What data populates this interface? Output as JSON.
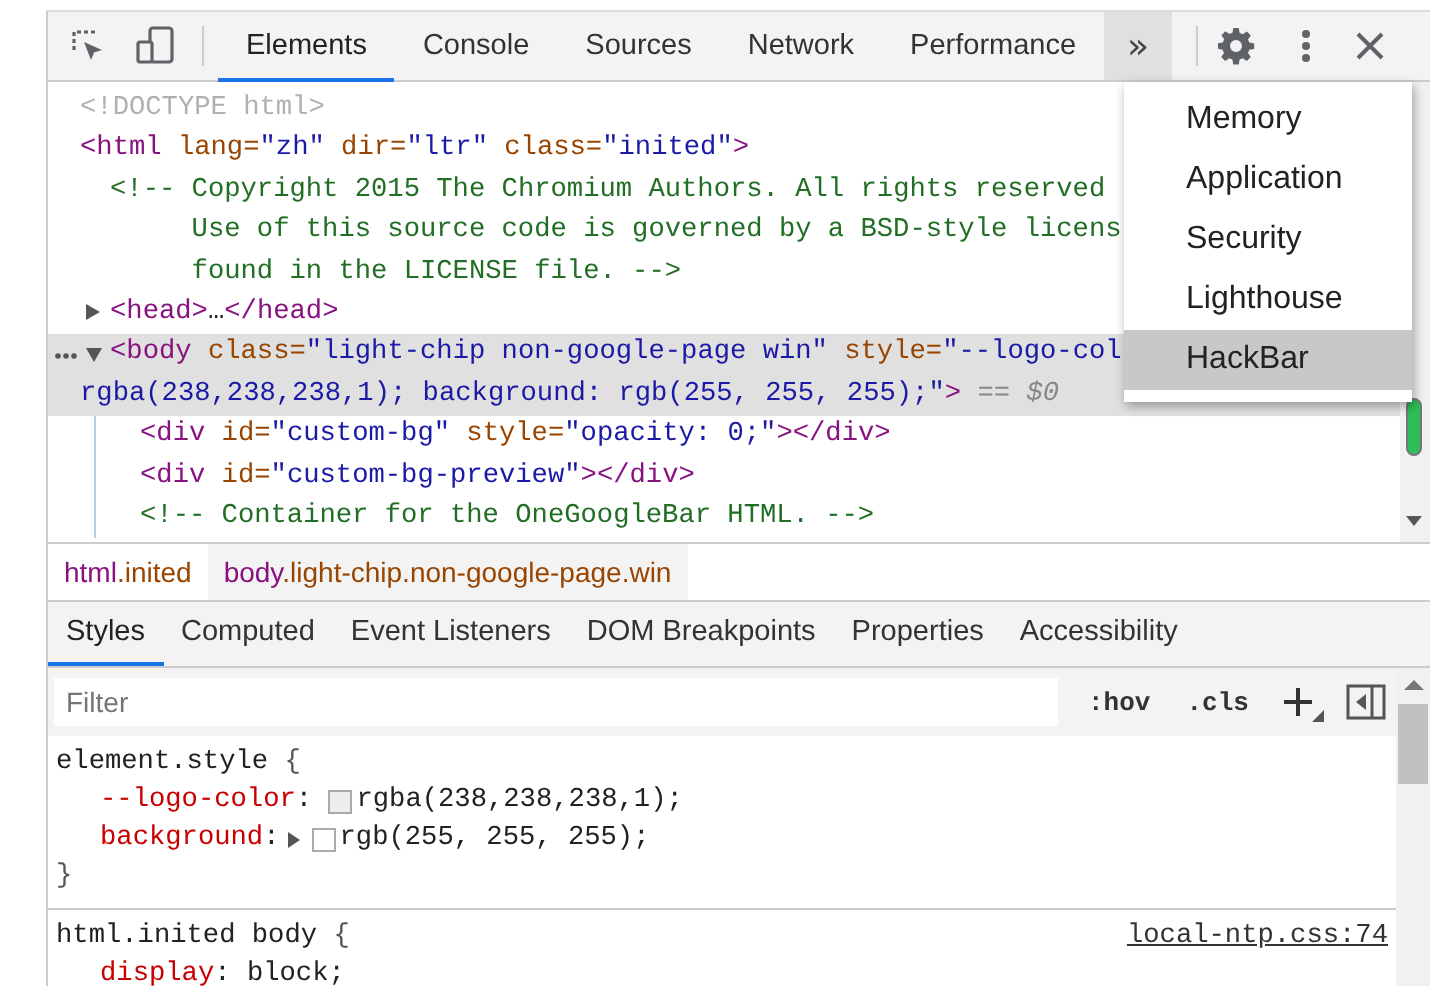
{
  "toolbar": {
    "tabs": [
      {
        "label": "Elements",
        "selected": true
      },
      {
        "label": "Console",
        "selected": false
      },
      {
        "label": "Sources",
        "selected": false
      },
      {
        "label": "Network",
        "selected": false
      },
      {
        "label": "Performance",
        "selected": false
      }
    ],
    "more_button": {
      "text": "»",
      "open": true
    },
    "more_menu": [
      {
        "label": "Memory",
        "selected": false
      },
      {
        "label": "Application",
        "selected": false
      },
      {
        "label": "Security",
        "selected": false
      },
      {
        "label": "Lighthouse",
        "selected": false
      },
      {
        "label": "HackBar",
        "selected": true
      }
    ]
  },
  "dom_tree": [
    {
      "selected": false,
      "lines": [
        [
          {
            "kind": "doctype",
            "text": "<!DOCTYPE html>"
          }
        ]
      ]
    },
    {
      "selected": false,
      "lines": [
        [
          {
            "kind": "tag",
            "text": "<html"
          },
          {
            "kind": "attr",
            "text": " lang="
          },
          {
            "kind": "value",
            "text": "\"zh\""
          },
          {
            "kind": "attr",
            "text": " dir="
          },
          {
            "kind": "value",
            "text": "\"ltr\""
          },
          {
            "kind": "attr",
            "text": " class="
          },
          {
            "kind": "value",
            "text": "\"inited\""
          },
          {
            "kind": "tag",
            "text": ">"
          }
        ]
      ],
      "children": [
        {
          "selected": false,
          "lines": [
            [
              {
                "kind": "comment",
                "text": "<!-- Copyright 2015 The Chromium Authors. All rights reserved"
              }
            ],
            [
              {
                "kind": "comment",
                "text": "Use of this source code is governed by a BSD-style licens"
              }
            ],
            [
              {
                "kind": "comment",
                "text": "found in the LICENSE file. -->"
              }
            ]
          ]
        },
        {
          "selected": false,
          "expanded": false,
          "lines": [
            [
              {
                "kind": "tag",
                "text": "<head>"
              },
              {
                "kind": "text",
                "text": "…"
              },
              {
                "kind": "tag",
                "text": "</head>"
              }
            ]
          ]
        },
        {
          "selected": true,
          "expanded": true,
          "lines": [
            [
              {
                "kind": "tag",
                "text": "<body"
              },
              {
                "kind": "attr",
                "text": " class="
              },
              {
                "kind": "value",
                "text": "\"light-chip non-google-page win\""
              },
              {
                "kind": "attr",
                "text": " style="
              },
              {
                "kind": "value",
                "text": "\"--logo-col"
              }
            ],
            [
              {
                "kind": "value",
                "text": "rgba(238,238,238,1); background: rgb(255, 255, 255);\""
              },
              {
                "kind": "tag",
                "text": ">"
              },
              {
                "kind": "marker",
                "text": " == $0"
              }
            ]
          ],
          "children": [
            {
              "selected": false,
              "lines": [
                [
                  {
                    "kind": "tag",
                    "text": "<div"
                  },
                  {
                    "kind": "attr",
                    "text": " id="
                  },
                  {
                    "kind": "value",
                    "text": "\"custom-bg\""
                  },
                  {
                    "kind": "attr",
                    "text": " style="
                  },
                  {
                    "kind": "value",
                    "text": "\"opacity: 0;\""
                  },
                  {
                    "kind": "tag",
                    "text": "></div>"
                  }
                ]
              ]
            },
            {
              "selected": false,
              "lines": [
                [
                  {
                    "kind": "tag",
                    "text": "<div"
                  },
                  {
                    "kind": "attr",
                    "text": " id="
                  },
                  {
                    "kind": "value",
                    "text": "\"custom-bg-preview\""
                  },
                  {
                    "kind": "tag",
                    "text": "></div>"
                  }
                ]
              ]
            },
            {
              "selected": false,
              "lines": [
                [
                  {
                    "kind": "comment",
                    "text": "<!-- Container for the OneGoogleBar HTML. -->"
                  }
                ]
              ]
            }
          ]
        }
      ]
    }
  ],
  "breadcrumbs": [
    {
      "tag": "html",
      "classes": ".inited",
      "selected": false
    },
    {
      "tag": "body",
      "classes": ".light-chip.non-google-page.win",
      "selected": true
    }
  ],
  "styles_tabs": [
    {
      "label": "Styles",
      "selected": true
    },
    {
      "label": "Computed",
      "selected": false
    },
    {
      "label": "Event Listeners",
      "selected": false
    },
    {
      "label": "DOM Breakpoints",
      "selected": false
    },
    {
      "label": "Properties",
      "selected": false
    },
    {
      "label": "Accessibility",
      "selected": false
    }
  ],
  "filter": {
    "placeholder": "Filter",
    "hov": ":hov",
    "cls": ".cls"
  },
  "rules": [
    {
      "selector": "element.style",
      "open_brace": " {",
      "close_brace": "}",
      "properties": [
        {
          "name": "--logo-color",
          "colon": ": ",
          "color": "#eeeeee",
          "value": "rgba(238,238,238,1);"
        },
        {
          "name": "background",
          "colon": ":",
          "expandable": true,
          "color": "#ffffff",
          "value": "rgb(255, 255, 255);"
        }
      ]
    },
    {
      "selector": "html.inited body",
      "open_brace": " {",
      "source": "local-ntp.css:74",
      "properties": [
        {
          "name": "display",
          "colon": ": ",
          "value": "block;"
        }
      ]
    }
  ]
}
